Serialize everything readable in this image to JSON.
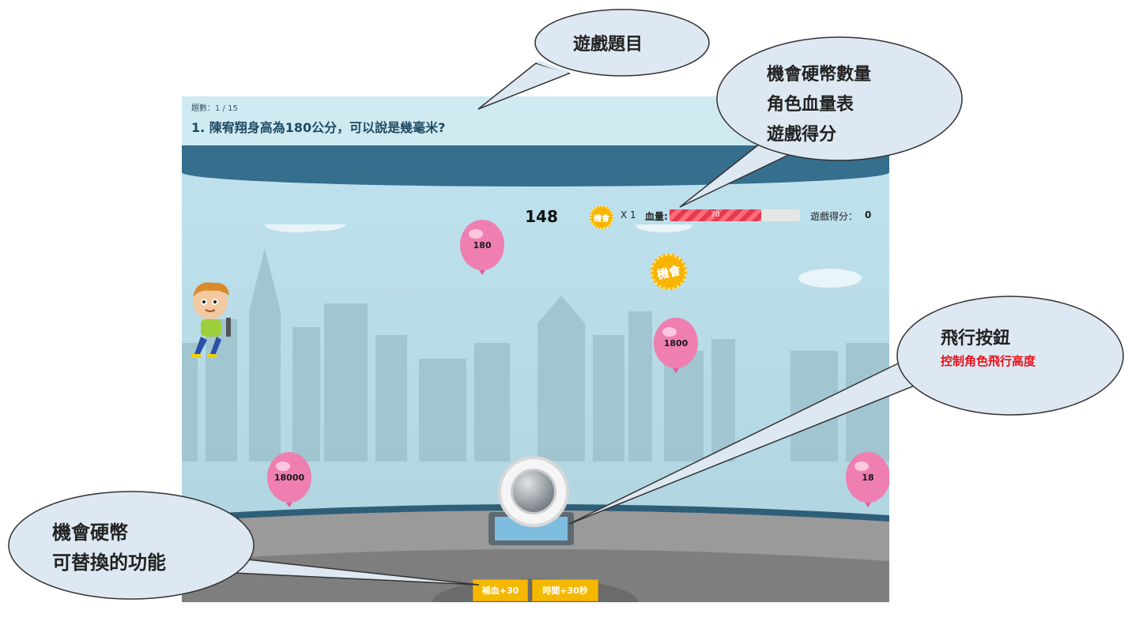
{
  "question": {
    "counter": "題數：1 / 15",
    "text": "1. 陳宥翔身高為180公分，可以說是幾毫米?"
  },
  "hud": {
    "timer": "148",
    "coin_icon_label": "機會",
    "coin_count": "X 1",
    "hp_label": "血量:",
    "hp_value": "70",
    "hp_fraction": 0.7,
    "score_label": "遊戲得分：",
    "score_value": "0"
  },
  "balloons": [
    {
      "label": "180"
    },
    {
      "label": "1800"
    },
    {
      "label": "18000"
    },
    {
      "label": "18"
    }
  ],
  "bonus_coin": {
    "label": "機會"
  },
  "powerups": {
    "heal": "補血+30",
    "time": "時間+30秒"
  },
  "callouts": {
    "title": "遊戲題目",
    "hud_line1": "機會硬幣數量",
    "hud_line2": "角色血量表",
    "hud_line3": "遊戲得分",
    "fly_title": "飛行按鈕",
    "fly_sub": "控制角色飛行高度",
    "coin_line1": "機會硬幣",
    "coin_line2": "可替換的功能"
  },
  "colors": {
    "accent_red": "#e8101a",
    "balloon_pink": "#ef7fb0",
    "coin_gold": "#f5b800",
    "roof_blue": "#366e8e"
  },
  "icons": [
    "coin-icon",
    "balloon-icon",
    "player-character",
    "fly-button-icon"
  ]
}
